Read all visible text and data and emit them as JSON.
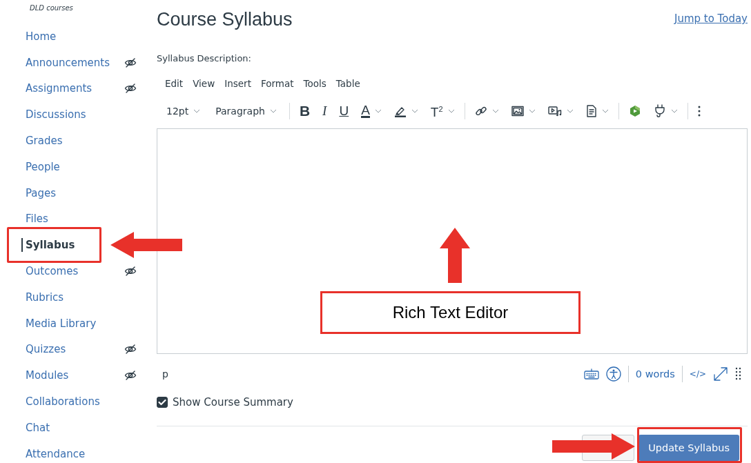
{
  "course_label": "DLD courses",
  "sidebar": {
    "items": [
      {
        "label": "Home",
        "selected": false,
        "hidden": false
      },
      {
        "label": "Announcements",
        "selected": false,
        "hidden": true
      },
      {
        "label": "Assignments",
        "selected": false,
        "hidden": true
      },
      {
        "label": "Discussions",
        "selected": false,
        "hidden": false
      },
      {
        "label": "Grades",
        "selected": false,
        "hidden": false
      },
      {
        "label": "People",
        "selected": false,
        "hidden": false
      },
      {
        "label": "Pages",
        "selected": false,
        "hidden": false
      },
      {
        "label": "Files",
        "selected": false,
        "hidden": false
      },
      {
        "label": "Syllabus",
        "selected": true,
        "hidden": false
      },
      {
        "label": "Outcomes",
        "selected": false,
        "hidden": true
      },
      {
        "label": "Rubrics",
        "selected": false,
        "hidden": false
      },
      {
        "label": "Media Library",
        "selected": false,
        "hidden": false
      },
      {
        "label": "Quizzes",
        "selected": false,
        "hidden": true
      },
      {
        "label": "Modules",
        "selected": false,
        "hidden": true
      },
      {
        "label": "Collaborations",
        "selected": false,
        "hidden": false
      },
      {
        "label": "Chat",
        "selected": false,
        "hidden": false
      },
      {
        "label": "Attendance",
        "selected": false,
        "hidden": false
      }
    ]
  },
  "page": {
    "title": "Course Syllabus",
    "jump_link": "Jump to Today",
    "field_label": "Syllabus Description:"
  },
  "editor": {
    "menus": [
      "Edit",
      "View",
      "Insert",
      "Format",
      "Tools",
      "Table"
    ],
    "toolbar": [
      {
        "kind": "select",
        "label": "12pt",
        "dropdown": true
      },
      {
        "kind": "select",
        "label": "Paragraph",
        "dropdown": true
      },
      {
        "kind": "separator"
      },
      {
        "kind": "bold",
        "label": "B",
        "dropdown": false
      },
      {
        "kind": "italic",
        "label": "I",
        "dropdown": false
      },
      {
        "kind": "underline",
        "label": "U",
        "dropdown": false
      },
      {
        "kind": "text-color",
        "label": "A",
        "dropdown": true
      },
      {
        "kind": "highlight",
        "dropdown": true
      },
      {
        "kind": "superscript",
        "label": "T$^{2}$",
        "dropdown": true
      },
      {
        "kind": "separator"
      },
      {
        "kind": "link",
        "dropdown": true
      },
      {
        "kind": "image",
        "dropdown": true
      },
      {
        "kind": "media",
        "dropdown": true
      },
      {
        "kind": "document",
        "dropdown": true
      },
      {
        "kind": "separator"
      },
      {
        "kind": "app",
        "dropdown": false
      },
      {
        "kind": "plugin",
        "dropdown": true
      },
      {
        "kind": "separator"
      },
      {
        "kind": "more",
        "dropdown": false
      }
    ],
    "status": {
      "path": "p",
      "word_count": "0 words",
      "html_toggle": "</>"
    }
  },
  "show_summary": {
    "label": "Show Course Summary",
    "checked": true
  },
  "actions": {
    "update_button": "Update Syllabus"
  },
  "annotations": [
    {
      "kind": "frame-sidebar"
    },
    {
      "kind": "arrow-left"
    },
    {
      "kind": "arrow-up"
    },
    {
      "kind": "callout",
      "text": "Rich Text Editor"
    },
    {
      "kind": "arrow-right"
    },
    {
      "kind": "frame-update"
    }
  ]
}
